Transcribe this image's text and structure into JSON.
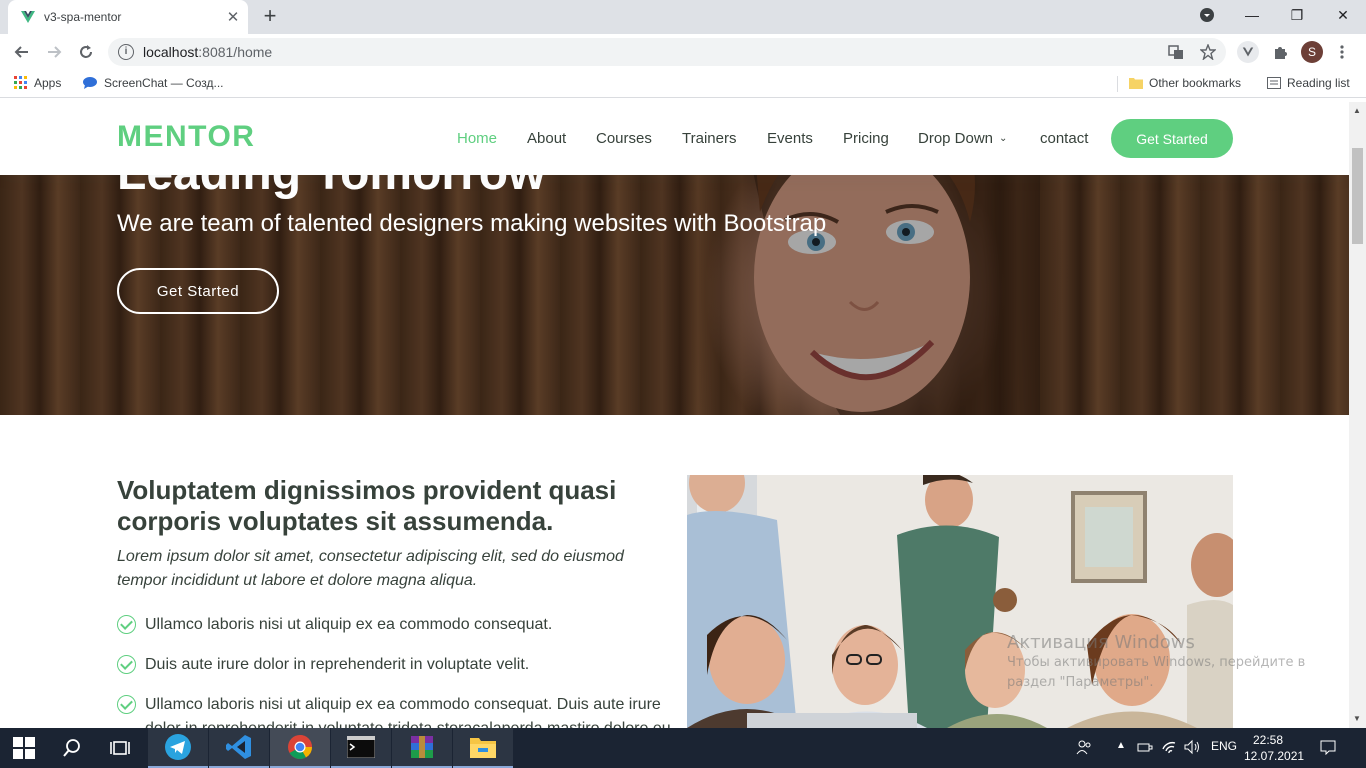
{
  "browser": {
    "tab_title": "v3-spa-mentor",
    "tab_close": "✕",
    "new_tab": "+",
    "window_controls": {
      "minimize": "—",
      "maximize": "❐",
      "close": "✕"
    },
    "url_host": "localhost",
    "url_path": ":8081/home",
    "profile_initial": "S",
    "bookmarks": {
      "apps": "Apps",
      "screenchat": "ScreenChat — Созд...",
      "other": "Other bookmarks",
      "reading_list": "Reading list"
    }
  },
  "site": {
    "logo": "MENTOR",
    "nav": [
      "Home",
      "About",
      "Courses",
      "Trainers",
      "Events",
      "Pricing",
      "Drop Down",
      "contact"
    ],
    "nav_cta": "Get Started",
    "hero": {
      "title": "Leading Tomorrow",
      "subtitle": "We are team of talented designers making websites with Bootstrap",
      "button": "Get Started"
    },
    "about": {
      "title": "Voluptatem dignissimos provident quasi corporis voluptates sit assumenda.",
      "lead": "Lorem ipsum dolor sit amet, consectetur adipiscing elit, sed do eiusmod tempor incididunt ut labore et dolore magna aliqua.",
      "items": [
        "Ullamco laboris nisi ut aliquip ex ea commodo consequat.",
        "Duis aute irure dolor in reprehenderit in voluptate velit.",
        "Ullamco laboris nisi ut aliquip ex ea commodo consequat. Duis aute irure dolor in reprehenderit in voluptate trideta storacalaperda mastiro dolore eu"
      ]
    }
  },
  "watermark": {
    "title": "Активация Windows",
    "line1": "Чтобы активировать Windows, перейдите в",
    "line2": "раздел \"Параметры\"."
  },
  "taskbar": {
    "language": "ENG",
    "time": "22:58",
    "date": "12.07.2021"
  },
  "colors": {
    "accent": "#5fcf80",
    "text": "#37423b",
    "taskbar": "#1b2433"
  }
}
